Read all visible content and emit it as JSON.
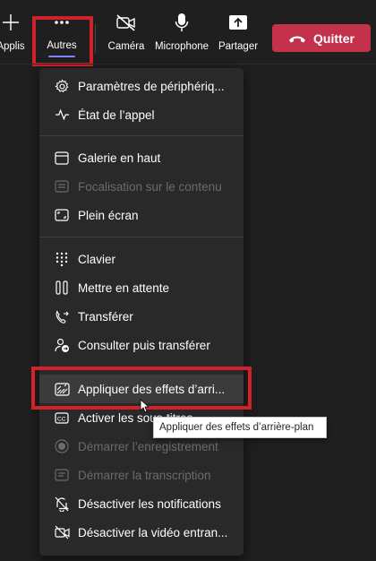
{
  "toolbar": {
    "applis_label": "Applis",
    "autres_label": "Autres",
    "camera_label": "Caméra",
    "microphone_label": "Microphone",
    "partager_label": "Partager",
    "quitter_label": "Quitter"
  },
  "colors": {
    "accent": "#7f85f5",
    "quit_button": "#c4314b",
    "highlight_box": "#d3212a",
    "menu_background": "#292929"
  },
  "menu": {
    "items": [
      {
        "label": "Paramètres de périphériq...",
        "icon": "gear-icon",
        "disabled": false
      },
      {
        "label": "État de l’appel",
        "icon": "pulse-icon",
        "disabled": false
      },
      {
        "label": "Galerie en haut",
        "icon": "gallery-icon",
        "disabled": false
      },
      {
        "label": "Focalisation sur le contenu",
        "icon": "focus-icon",
        "disabled": true
      },
      {
        "label": "Plein écran",
        "icon": "fullscreen-icon",
        "disabled": false
      },
      {
        "label": "Clavier",
        "icon": "dialpad-icon",
        "disabled": false
      },
      {
        "label": "Mettre en attente",
        "icon": "pause-icon",
        "disabled": false
      },
      {
        "label": "Transférer",
        "icon": "transfer-icon",
        "disabled": false
      },
      {
        "label": "Consulter puis transférer",
        "icon": "consult-transfer-icon",
        "disabled": false
      },
      {
        "label": "Appliquer des effets d’arri...",
        "icon": "background-effects-icon",
        "disabled": false
      },
      {
        "label": "Activer les sous-titres",
        "icon": "captions-icon",
        "disabled": false
      },
      {
        "label": "Démarrer l’enregistrement",
        "icon": "record-icon",
        "disabled": true
      },
      {
        "label": "Démarrer la transcription",
        "icon": "transcript-icon",
        "disabled": true
      },
      {
        "label": "Désactiver les notifications",
        "icon": "bell-off-icon",
        "disabled": false
      },
      {
        "label": "Désactiver la vidéo entran...",
        "icon": "video-off-icon",
        "disabled": false
      }
    ]
  },
  "tooltip": {
    "text": "Appliquer des effets d’arrière-plan"
  }
}
